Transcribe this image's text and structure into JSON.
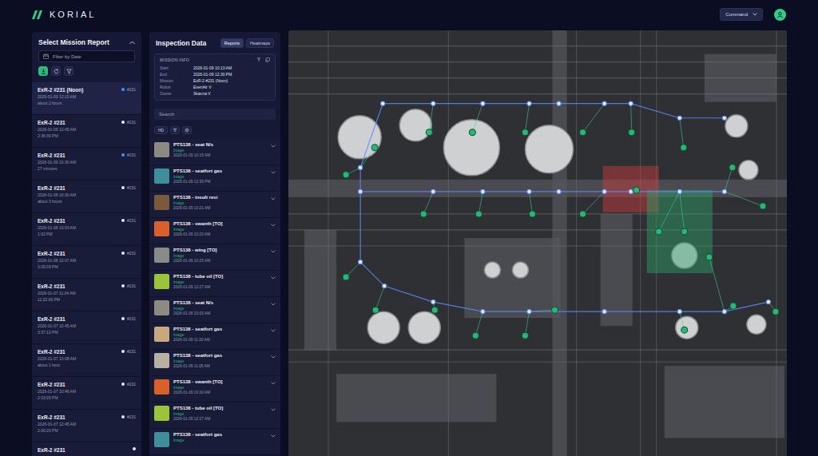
{
  "header": {
    "logo": "KORIAL",
    "command": "Command"
  },
  "missions": {
    "title": "Select Mission Report",
    "filter_placeholder": "Filter by Date",
    "toolbar": [
      {
        "kind": "download",
        "selected": true
      },
      {
        "kind": "refresh",
        "selected": false
      },
      {
        "kind": "filter",
        "selected": false
      }
    ],
    "items": [
      {
        "title": "ExR-2 #231 (Noon)",
        "date": "2026-01-09 12:15 AM",
        "ago": "about 2 hours",
        "badge": "#231",
        "color": "#4d8dff",
        "selected": true
      },
      {
        "title": "ExR-2 #231",
        "date": "2026-01-09 12:45 AM",
        "ago": "2:36:36 PM",
        "badge": "#231",
        "color": "#e6e8f0",
        "selected": false
      },
      {
        "title": "ExR-2 #231",
        "date": "2026-01-09 10:30 AM",
        "ago": "27 minutes",
        "badge": "#231",
        "color": "#4d8dff",
        "selected": false
      },
      {
        "title": "ExR-2 #231",
        "date": "2026-01-08 10:30 AM",
        "ago": "about 3 hours",
        "badge": "#231",
        "color": "#e6e8f0",
        "selected": false
      },
      {
        "title": "ExR-2 #231",
        "date": "2026-01-08 13:03 AM",
        "ago": "1:02 PM",
        "badge": "#231",
        "color": "#e6e8f0",
        "selected": false
      },
      {
        "title": "ExR-2 #231",
        "date": "2026-01-08 12:07 AM",
        "ago": "3:05:09 PM",
        "badge": "#231",
        "color": "#e6e8f0",
        "selected": false
      },
      {
        "title": "ExR-2 #231",
        "date": "2026-01-07 11:04 AM",
        "ago": "11:22:06 PM",
        "badge": "#231",
        "color": "#e6e8f0",
        "selected": false
      },
      {
        "title": "ExR-2 #231",
        "date": "2026-01-07 10:45 AM",
        "ago": "3:37:10 PM",
        "badge": "#231",
        "color": "#e6e8f0",
        "selected": false
      },
      {
        "title": "ExR-2 #231",
        "date": "2026-01-07 10:08 AM",
        "ago": "about 1 hour",
        "badge": "#231",
        "color": "#e6e8f0",
        "selected": false
      },
      {
        "title": "ExR-2 #231",
        "date": "2026-01-07 10:46 AM",
        "ago": "2:03:05 PM",
        "badge": "#231",
        "color": "#e6e8f0",
        "selected": false
      },
      {
        "title": "ExR-2 #231",
        "date": "2026-01-07 12:45 AM",
        "ago": "2:00:20 PM",
        "badge": "#231",
        "color": "#e6e8f0",
        "selected": false
      },
      {
        "title": "ExR-2 #231",
        "date": "",
        "ago": "",
        "badge": "",
        "color": "#e6e8f0",
        "selected": false
      }
    ]
  },
  "inspection": {
    "title": "Inspection Data",
    "tabs": [
      {
        "label": "Reports",
        "selected": true
      },
      {
        "label": "Heatmaps",
        "selected": false
      }
    ],
    "mission_info": {
      "title": "MISSION INFO",
      "rows": [
        {
          "label": "Start",
          "value": "2026-01-09 10:13 AM"
        },
        {
          "label": "End",
          "value": "2026-01-09 12:30 PM"
        },
        {
          "label": "Mission",
          "value": "ExR-2 #231 (Noon)"
        },
        {
          "label": "Robot",
          "value": "ExertAir V"
        },
        {
          "label": "Owner",
          "value": "Skanna V"
        }
      ]
    },
    "search_placeholder": "Search",
    "filters": [
      {
        "label": "HD"
      }
    ],
    "items": [
      {
        "title": "PTS138 - seat N/s",
        "type": "Image",
        "date": "2026-01-09 10:15 AM",
        "color": "#8c8a82"
      },
      {
        "title": "PTS138 - seatfort gas",
        "type": "Image",
        "date": "2026-01-09 12:30 PM",
        "color": "#3f8f9a"
      },
      {
        "title": "PTS138 - insult resi",
        "type": "Image",
        "date": "2026-01-09 10:21 AM",
        "color": "#7a5a3a"
      },
      {
        "title": "PTS138 - swanth [TO]",
        "type": "Image",
        "date": "2026-01-09 10:20 AM",
        "color": "#d9602a"
      },
      {
        "title": "PTS138 - wing [TO]",
        "type": "Image",
        "date": "2026-01-09 10:25 AM",
        "color": "#8a8a8a"
      },
      {
        "title": "PTS138 - tube oil [TO]",
        "type": "Image",
        "date": "2026-01-09 12:27 AM",
        "color": "#9bc43a"
      },
      {
        "title": "PTS138 - seat N/s",
        "type": "Image",
        "date": "2026-01-09 10:03 AM",
        "color": "#8c8a82"
      },
      {
        "title": "PTS138 - seatfort gas",
        "type": "Image",
        "date": "2026-01-09 11:20 AM",
        "color": "#c9a880"
      },
      {
        "title": "PTS138 - seatfort gas",
        "type": "Image",
        "date": "2026-01-09 11:05 AM",
        "color": "#b8b0a0"
      },
      {
        "title": "PTS138 - swanth [TO]",
        "type": "Image",
        "date": "2026-01-09 10:20 AM",
        "color": "#d9602a"
      },
      {
        "title": "PTS138 - tube oil [TO]",
        "type": "Image",
        "date": "2026-01-09 12:27 AM",
        "color": "#9bc43a"
      },
      {
        "title": "PTS138 - seatfort gas",
        "type": "Image",
        "date": "",
        "color": "#3f8f9a"
      }
    ]
  },
  "map": {
    "zones": [
      {
        "status": "alert",
        "color": "#d23c3c"
      },
      {
        "status": "ok",
        "color": "#2ea56a"
      }
    ]
  }
}
